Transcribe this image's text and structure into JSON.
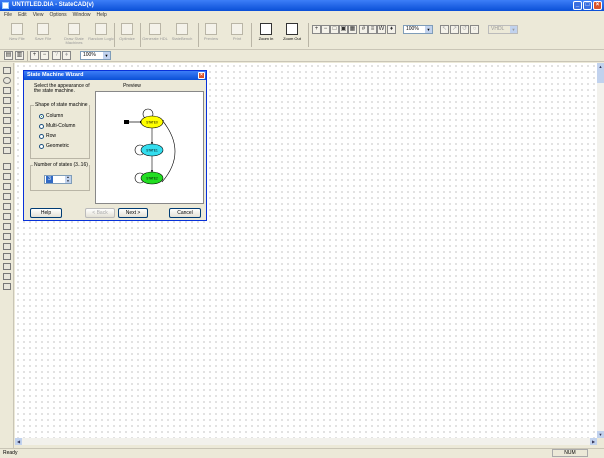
{
  "window": {
    "title": "UNTITLED.DIA - StateCAD(v)"
  },
  "menu": [
    "File",
    "Edit",
    "View",
    "Options",
    "Window",
    "Help"
  ],
  "toolbar1": {
    "buttons": [
      {
        "label": "New File",
        "icon": "new-file-icon"
      },
      {
        "label": "Save File",
        "icon": "save-icon"
      },
      {
        "label": "Draw State Machines",
        "icon": "draw-state-machines-icon"
      },
      {
        "label": "Random Logic",
        "icon": "random-logic-icon"
      },
      {
        "label": "Optimize",
        "icon": "optimize-icon"
      },
      {
        "label": "Generate HDL",
        "icon": "generate-hdl-icon"
      },
      {
        "label": "StateBench",
        "icon": "statebench-icon"
      },
      {
        "label": "Preview",
        "icon": "preview-icon"
      },
      {
        "label": "Print",
        "icon": "print-icon"
      },
      {
        "label": "Zoom In",
        "icon": "zoom-in-icon"
      },
      {
        "label": "Zoom Out",
        "icon": "zoom-out-icon"
      }
    ],
    "zoom_value": "100%",
    "vhdl_value": "VHDL"
  },
  "toolbar2": {
    "zoom_value": "100%"
  },
  "dialog": {
    "title": "State Machine Wizard",
    "instruction": "Select the appearance of the state machine.",
    "shape_group": "Shape of state machine",
    "shapes": [
      "Column",
      "Multi-Column",
      "Row",
      "Geometric"
    ],
    "selected_shape": "Column",
    "states_label": "Number of states (3..16)",
    "states_value": "3",
    "preview_label": "Preview",
    "buttons": {
      "help": "Help",
      "back": "< Back",
      "next": "Next >",
      "cancel": "Cancel"
    },
    "preview_states": [
      {
        "name": "STATE0",
        "color": "#ffff00"
      },
      {
        "name": "STATE1",
        "color": "#33ddee"
      },
      {
        "name": "STATE2",
        "color": "#22dd22"
      }
    ]
  },
  "status": {
    "left": "Ready",
    "right": "NUM"
  }
}
